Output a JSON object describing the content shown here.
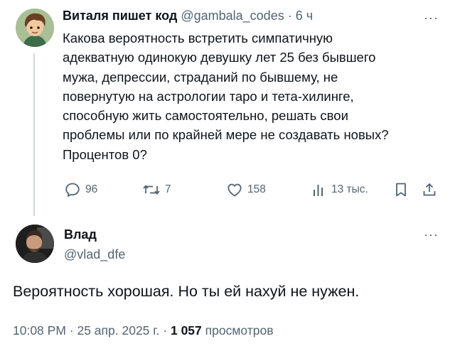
{
  "original_tweet": {
    "author_name": "Виталя пишет код",
    "handle": "@gambala_codes",
    "separator": "·",
    "time_ago": "6 ч",
    "text": "Какова вероятность встретить симпатичную\nадекватную одинокую девушку лет 25 без бывшего\nмужа, депрессии, страданий по бывшему, не\nповернутую на астрологии таро и тета-хилинге,\nспособную жить самостоятельно, решать свои\nпроблемы или по крайней мере не создавать новых?\nПроцентов 0?",
    "actions": {
      "replies": "96",
      "reposts": "7",
      "likes": "158",
      "views": "13 тыс."
    }
  },
  "reply_tweet": {
    "author_name": "Влад",
    "handle": "@vlad_dfe",
    "text": "Вероятность хорошая. Но ты ей нахуй не нужен.",
    "meta": {
      "time": "10:08 PM",
      "sep1": "·",
      "date": "25 апр. 2025 г.",
      "sep2": "·",
      "views_count": "1 057",
      "views_label": "просмотров"
    }
  },
  "more_glyph": "···",
  "colors": {
    "text": "#0f1419",
    "muted": "#536471",
    "line": "#cfd9de"
  }
}
